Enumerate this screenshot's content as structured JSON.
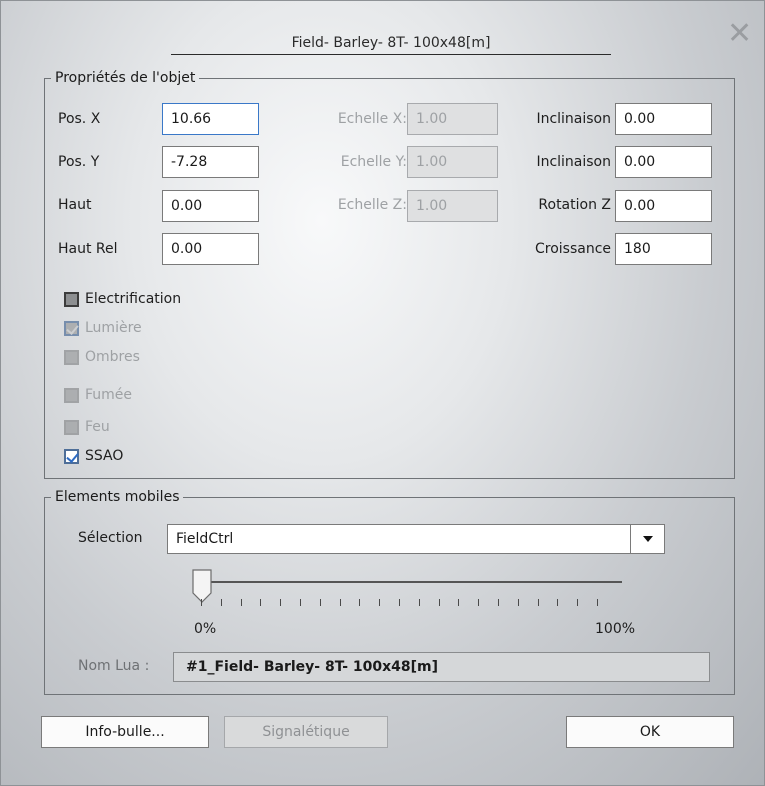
{
  "dialog": {
    "title": "Field- Barley- 8T- 100x48[m]"
  },
  "props": {
    "legend": "Propriétés de l'objet",
    "pos_x_label": "Pos. X",
    "pos_x_value": "10.66",
    "pos_y_label": "Pos. Y",
    "pos_y_value": "-7.28",
    "haut_label": "Haut",
    "haut_value": "0.00",
    "hautrel_label": "Haut Rel",
    "hautrel_value": "0.00",
    "echx_label": "Echelle X:",
    "echx_value": "1.00",
    "echy_label": "Echelle Y:",
    "echy_value": "1.00",
    "echz_label": "Echelle Z:",
    "echz_value": "1.00",
    "incl1_label": "Inclinaison",
    "incl1_value": "0.00",
    "incl2_label": "Inclinaison",
    "incl2_value": "0.00",
    "rotz_label": "Rotation Z",
    "rotz_value": "0.00",
    "croiss_label": "Croissance",
    "croiss_value": "180",
    "checkboxes": [
      {
        "label": "Electrification",
        "checked": false,
        "enabled": true
      },
      {
        "label": "Lumière",
        "checked": true,
        "enabled": false
      },
      {
        "label": "Ombres",
        "checked": false,
        "enabled": false
      },
      {
        "label": "Fumée",
        "checked": false,
        "enabled": false
      },
      {
        "label": "Feu",
        "checked": false,
        "enabled": false
      },
      {
        "label": "SSAO",
        "checked": true,
        "enabled": true
      }
    ]
  },
  "mobiles": {
    "legend": "Elements mobiles",
    "selection_label": "Sélection",
    "selection_value": "FieldCtrl",
    "slider_value_percent": 0,
    "slider_min_label": "0%",
    "slider_max_label": "100%",
    "nomlua_label": "Nom Lua :",
    "nomlua_value": "#1_Field- Barley- 8T- 100x48[m]"
  },
  "buttons": {
    "info": "Info-bulle...",
    "signal": "Signalétique",
    "ok": "OK"
  },
  "icons": {
    "close": "close-icon",
    "dropdown": "chevron-down-icon"
  }
}
